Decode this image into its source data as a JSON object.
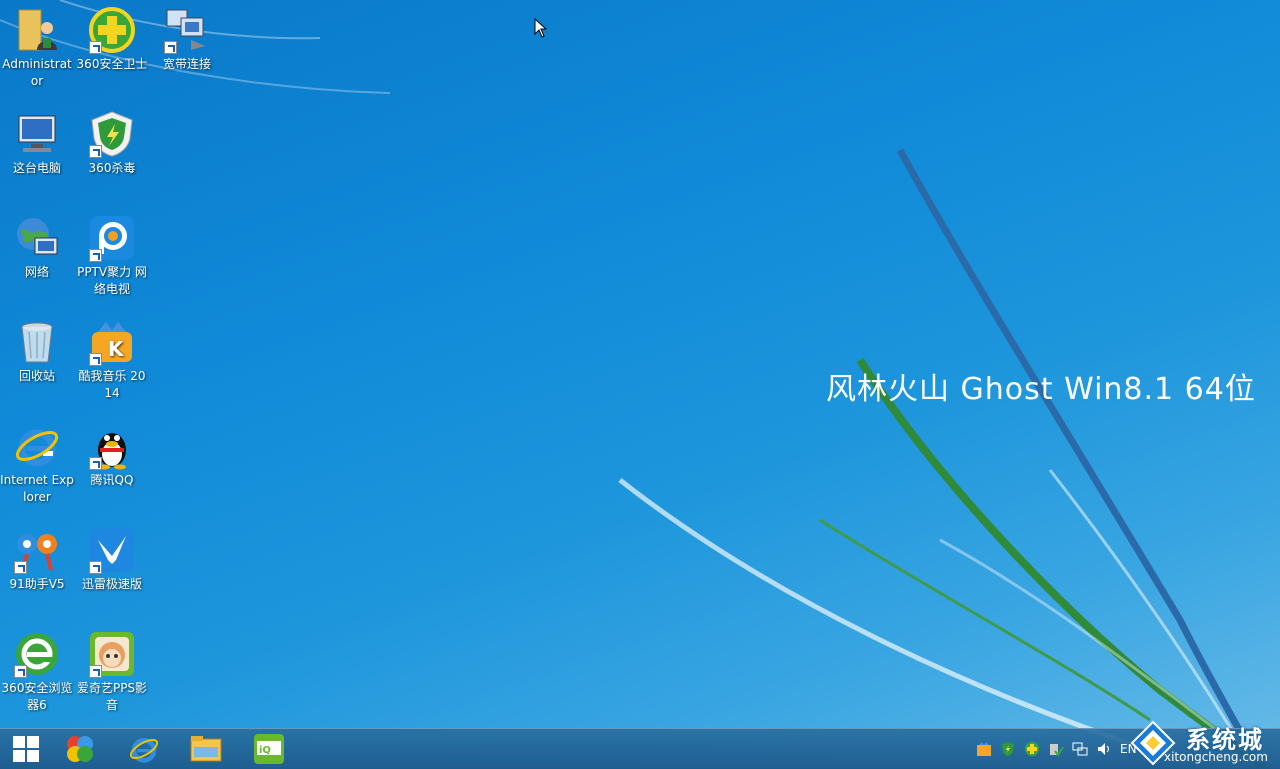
{
  "wallpaper": {
    "brand_text": "风林火山 Ghost Win8.1 64位"
  },
  "desktop_icons": [
    {
      "id": "administrator",
      "label": "Administrator",
      "icon": "folder-user-icon"
    },
    {
      "id": "360safe",
      "label": "360安全卫士",
      "icon": "360-safe-icon"
    },
    {
      "id": "broadband",
      "label": "宽带连接",
      "icon": "broadband-icon"
    },
    {
      "id": "this-pc",
      "label": "这台电脑",
      "icon": "computer-icon"
    },
    {
      "id": "360av",
      "label": "360杀毒",
      "icon": "360-antivirus-icon"
    },
    {
      "id": "network",
      "label": "网络",
      "icon": "network-icon"
    },
    {
      "id": "pptv",
      "label": "PPTV聚力 网络电视",
      "icon": "pptv-icon"
    },
    {
      "id": "recycle",
      "label": "回收站",
      "icon": "recycle-bin-icon"
    },
    {
      "id": "kuwo",
      "label": "酷我音乐 2014",
      "icon": "kuwo-music-icon"
    },
    {
      "id": "ie",
      "label": "Internet Explorer",
      "icon": "internet-explorer-icon"
    },
    {
      "id": "qq",
      "label": "腾讯QQ",
      "icon": "qq-penguin-icon"
    },
    {
      "id": "91",
      "label": "91助手V5",
      "icon": "91-assistant-icon"
    },
    {
      "id": "xunlei",
      "label": "迅雷极速版",
      "icon": "xunlei-icon"
    },
    {
      "id": "360browser",
      "label": "360安全浏览器6",
      "icon": "360-browser-icon"
    },
    {
      "id": "pps",
      "label": "爱奇艺PPS影音",
      "icon": "iqiyi-pps-icon"
    }
  ],
  "taskbar": {
    "pinned": [
      "windows-start-icon",
      "360-app-icon",
      "internet-explorer-icon",
      "file-explorer-icon",
      "iqiyi-icon"
    ],
    "tray": {
      "language": "EN"
    }
  },
  "watermark": {
    "brand": "系统城",
    "url": "xitongcheng.com"
  },
  "colors": {
    "desktop_blue": "#108ad8",
    "taskbar": "#286ea0"
  }
}
